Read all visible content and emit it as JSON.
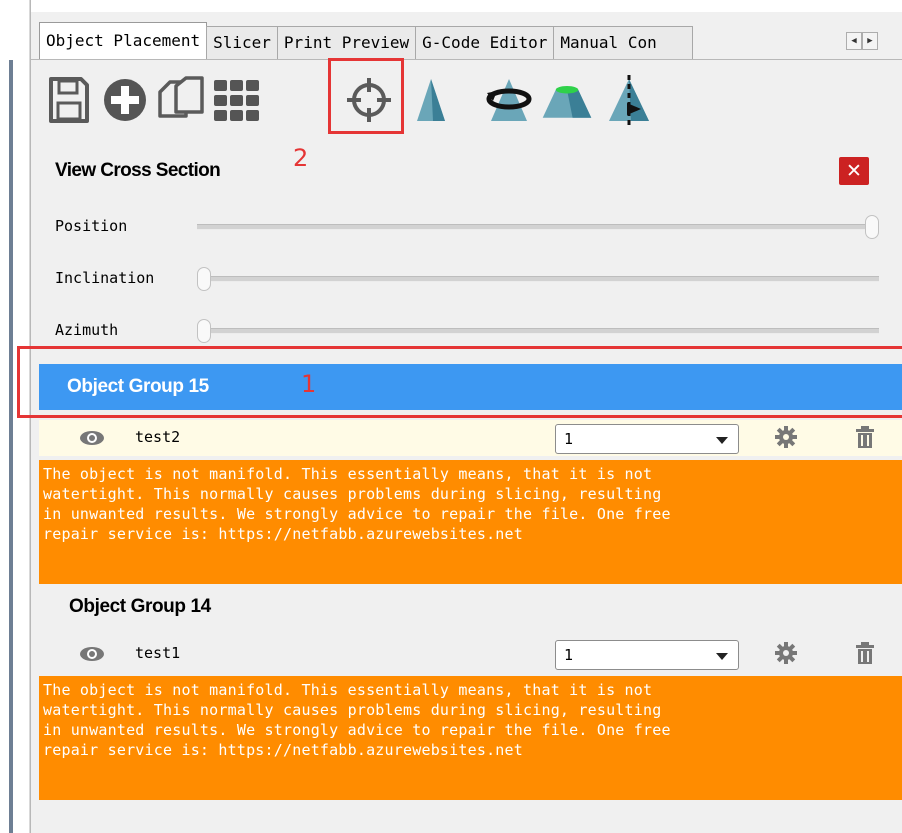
{
  "tabs": {
    "items": [
      "Object Placement",
      "Slicer",
      "Print Preview",
      "G-Code Editor",
      "Manual Con"
    ],
    "active_index": 0,
    "scroll_left": "◀",
    "scroll_right": "▶"
  },
  "toolbar": {
    "buttons": [
      "save-icon",
      "add-icon",
      "copy-icon",
      "grid-icon",
      "cross-section-icon",
      "mirror-icon",
      "rotate-icon",
      "place-flat-icon",
      "cut-icon"
    ]
  },
  "annotations": {
    "one": "1",
    "two": "2"
  },
  "cross_section": {
    "title": "View Cross Section",
    "close_label": "✕",
    "sliders": [
      {
        "label": "Position",
        "value": 1.0
      },
      {
        "label": "Inclination",
        "value": 0.0
      },
      {
        "label": "Azimuth",
        "value": 0.0
      }
    ]
  },
  "groups": [
    {
      "title": "Object Group 15",
      "selected": true,
      "object": {
        "name": "test2",
        "extruder": "1"
      },
      "warning": "The object is not manifold. This essentially means, that it is not\nwatertight. This normally causes problems during slicing, resulting\nin unwanted results. We strongly advice to repair the file. One free\nrepair service is: https://netfabb.azurewebsites.net"
    },
    {
      "title": "Object Group 14",
      "selected": false,
      "object": {
        "name": "test1",
        "extruder": "1"
      },
      "warning": "The object is not manifold. This essentially means, that it is not\nwatertight. This normally causes problems during slicing, resulting\nin unwanted results. We strongly advice to repair the file. One free\nrepair service is: https://netfabb.azurewebsites.net"
    }
  ],
  "colors": {
    "selection": "#3d98f2",
    "warning_bg": "#ff8c00",
    "annotation": "#e53535",
    "close_bg": "#cc2222"
  }
}
